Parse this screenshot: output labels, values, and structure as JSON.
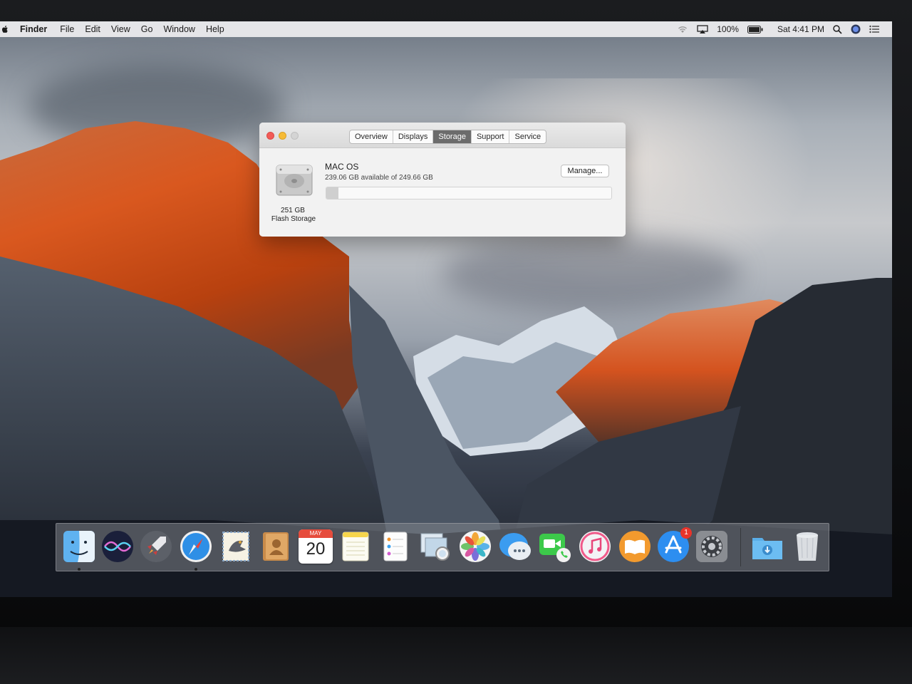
{
  "menubar": {
    "app_name": "Finder",
    "menus": [
      "File",
      "Edit",
      "View",
      "Go",
      "Window",
      "Help"
    ],
    "battery": "100%",
    "clock": "Sat 4:41 PM",
    "icons": [
      "apple-icon",
      "wifi-icon",
      "airplay-icon",
      "battery-icon",
      "spotlight-icon",
      "siri-icon",
      "notification-center-icon"
    ]
  },
  "window": {
    "tabs": [
      {
        "label": "Overview"
      },
      {
        "label": "Displays"
      },
      {
        "label": "Storage"
      },
      {
        "label": "Support"
      },
      {
        "label": "Service"
      }
    ],
    "active_tab": "Storage",
    "disk": {
      "capacity": "251 GB",
      "type": "Flash Storage"
    },
    "volume": {
      "name": "MAC OS",
      "available": "239.06 GB available of 249.66 GB",
      "used_fraction": 0.0425
    },
    "manage_label": "Manage..."
  },
  "dock": {
    "apps": [
      "finder-icon",
      "siri-icon",
      "launchpad-icon",
      "safari-icon",
      "mail-icon",
      "contacts-icon",
      "calendar-icon",
      "notes-icon",
      "reminders-icon",
      "preview-icon",
      "photos-icon",
      "messages-icon",
      "facetime-icon",
      "itunes-icon",
      "ibooks-icon",
      "app-store-icon",
      "system-preferences-icon",
      "downloads-folder-icon",
      "trash-icon"
    ],
    "calendar_month": "MAY",
    "calendar_day": "20",
    "app_store_badge": "1"
  }
}
